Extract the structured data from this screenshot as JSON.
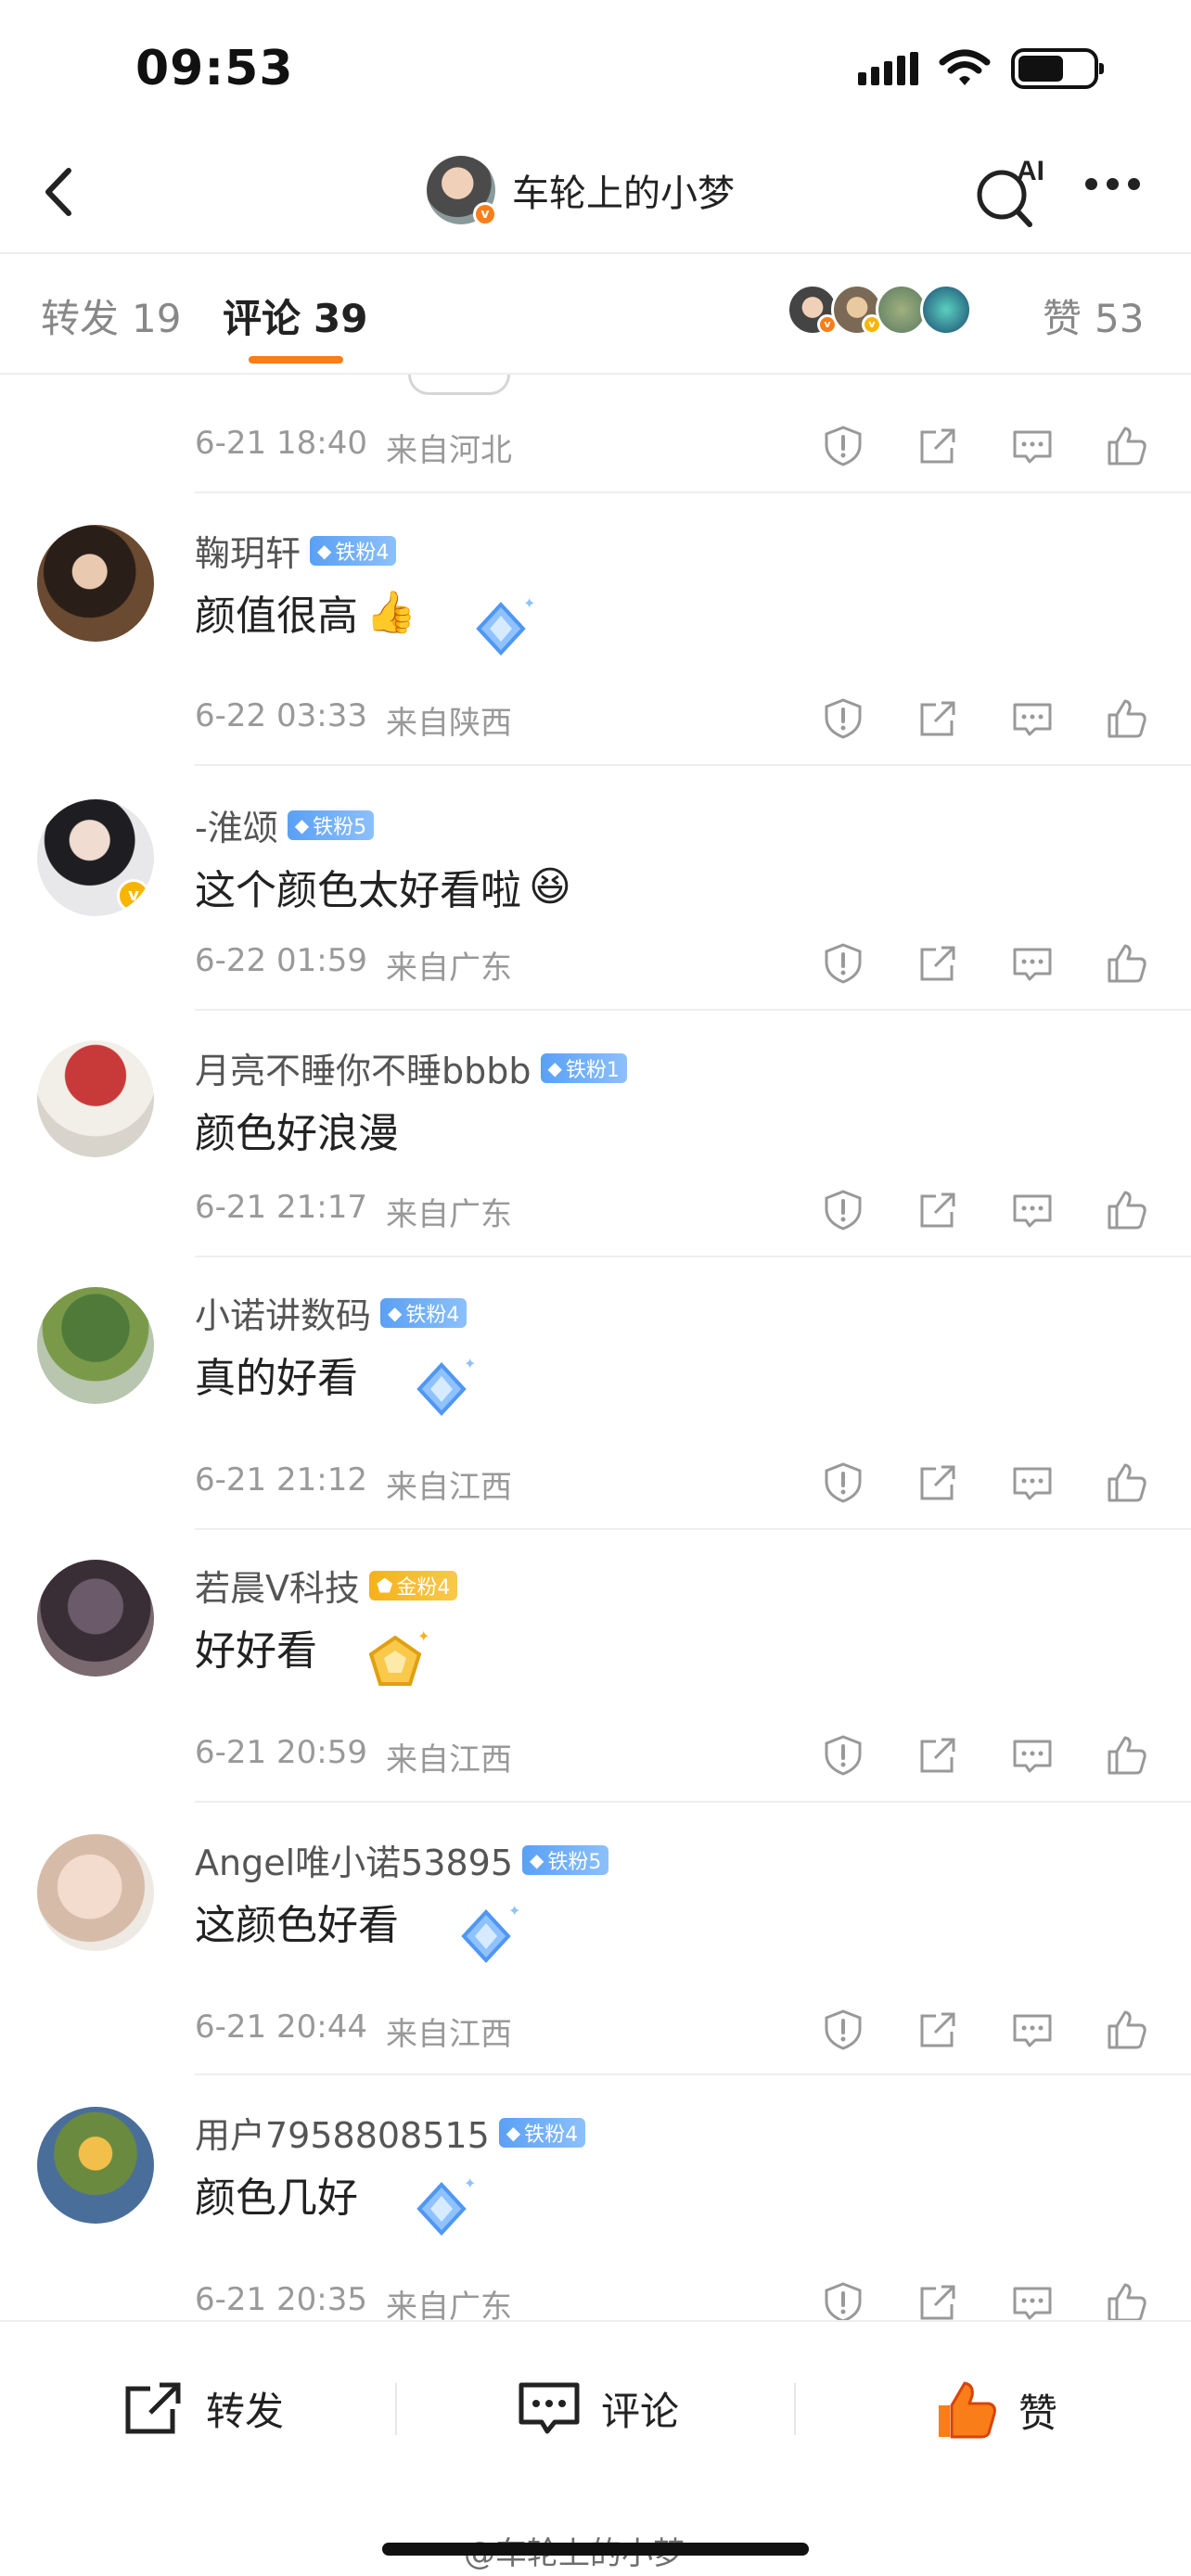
{
  "status_bar": {
    "time": "09:53"
  },
  "nav": {
    "title": "车轮上的小梦",
    "ai_label": "AI"
  },
  "tabs": {
    "repost": {
      "label": "转发",
      "count": "19"
    },
    "comment": {
      "label": "评论",
      "count": "39"
    },
    "like": {
      "label": "赞",
      "count": "53"
    }
  },
  "comments": [
    {
      "username": "",
      "text": "",
      "date": "6-21 18:40",
      "location": "来自河北"
    },
    {
      "username": "鞠玥轩",
      "badge": "铁粉4",
      "text": "颜值很高",
      "emoji": "👍",
      "date": "6-22 03:33",
      "location": "来自陕西"
    },
    {
      "username": "-淮颂",
      "badge": "铁粉5",
      "text": "这个颜色太好看啦",
      "emoji": "😆",
      "date": "6-22 01:59",
      "location": "来自广东"
    },
    {
      "username": "月亮不睡你不睡bbbb",
      "badge": "铁粉1",
      "text": "颜色好浪漫",
      "date": "6-21 21:17",
      "location": "来自广东"
    },
    {
      "username": "小诺讲数码",
      "badge": "铁粉4",
      "text": "真的好看",
      "date": "6-21 21:12",
      "location": "来自江西"
    },
    {
      "username": "若晨V科技",
      "badge": "金粉4",
      "text": "好好看",
      "date": "6-21 20:59",
      "location": "来自江西"
    },
    {
      "username": "Angel唯小诺53895",
      "badge": "铁粉5",
      "text": "这颜色好看",
      "date": "6-21 20:44",
      "location": "来自江西"
    },
    {
      "username": "用户7958808515",
      "badge": "铁粉4",
      "text": "颜色几好",
      "date": "6-21 20:35",
      "location": "来自广东"
    }
  ],
  "bottom_bar": {
    "repost": "转发",
    "comment": "评论",
    "like": "赞"
  },
  "watermark": "@车轮上的小梦",
  "colors": {
    "accent": "#f97d18",
    "badge_blue": "#5aa0f5",
    "badge_gold": "#f6b11b"
  },
  "icons": [
    "back-icon",
    "ai-search-icon",
    "more-icon",
    "report-icon",
    "share-icon",
    "reply-icon",
    "like-icon"
  ]
}
